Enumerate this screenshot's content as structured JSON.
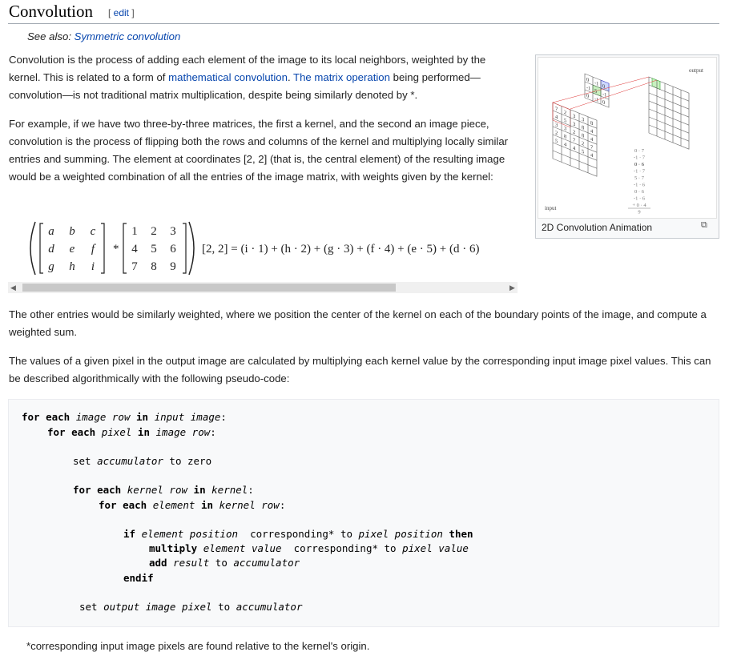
{
  "section": {
    "title": "Convolution",
    "edit_label": "edit",
    "edit_open": "[ ",
    "edit_close": " ]"
  },
  "see_also": {
    "prefix": "See also: ",
    "link": "Symmetric convolution"
  },
  "para1": {
    "text_a": "Convolution is the process of adding each element of the image to its local neighbors, weighted by the kernel. This is related to a form of ",
    "link1": "mathematical convolution",
    "text_b": ". ",
    "link2": "The matrix operation",
    "text_c": " being performed—convolution—is not traditional matrix multiplication, despite being similarly denoted by *."
  },
  "para2": "For example, if we have two three-by-three matrices, the first a kernel, and the second an image piece, convolution is the process of flipping both the rows and columns of the kernel and multiplying locally similar entries and summing. The element at coordinates [2, 2] (that is, the central element) of the resulting image would be a weighted combination of all the entries of the image matrix, with weights given by the kernel:",
  "figure": {
    "caption": "2D Convolution Animation",
    "label_output": "output",
    "label_input": "input",
    "kernel_grid": [
      [
        "0",
        "-1",
        "0"
      ],
      [
        "-1",
        "5",
        "-1"
      ],
      [
        "0",
        "-1",
        "0"
      ]
    ],
    "input_grid": [
      [
        "7",
        "2",
        "3",
        "3",
        "8"
      ],
      [
        "4",
        "5",
        "3",
        "8",
        "4"
      ],
      [
        "3",
        "3",
        "2",
        "8",
        "4"
      ],
      [
        "2",
        "8",
        "7",
        "2",
        "7"
      ],
      [
        "5",
        "4",
        "4",
        "5",
        "4"
      ]
    ],
    "calc_lines": [
      "0 · 7",
      "-1 · 7",
      "0 · 6",
      "-1 · 7",
      "5 · 7",
      "-1 · 6",
      "0 · 6",
      "-1 · 6",
      "+ 0 · 4",
      "9"
    ]
  },
  "equation": {
    "kernel": [
      [
        "a",
        "b",
        "c"
      ],
      [
        "d",
        "e",
        "f"
      ],
      [
        "g",
        "h",
        "i"
      ]
    ],
    "image": [
      [
        "1",
        "2",
        "3"
      ],
      [
        "4",
        "5",
        "6"
      ],
      [
        "7",
        "8",
        "9"
      ]
    ],
    "op": "*",
    "result": "[2, 2] = (i · 1) + (h · 2) + (g · 3) + (f · 4) + (e · 5) + (d · 6)"
  },
  "para3": "The other entries would be similarly weighted, where we position the center of the kernel on each of the boundary points of the image, and compute a weighted sum.",
  "para4": "The values of a given pixel in the output image are calculated by multiplying each kernel value by the corresponding input image pixel values. This can be described algorithmically with the following pseudo-code:",
  "pseudocode": {
    "l1": [
      "for each",
      " ",
      "image row",
      " ",
      "in",
      " ",
      "input image",
      ":"
    ],
    "l2": [
      "for each",
      " ",
      "pixel",
      " ",
      "in",
      " ",
      "image row",
      ":"
    ],
    "l3": [
      "set",
      " ",
      "accumulator",
      " to zero"
    ],
    "l4": [
      "for each",
      " ",
      "kernel row",
      " ",
      "in",
      " ",
      "kernel",
      ":"
    ],
    "l5": [
      "for each",
      " ",
      "element",
      " ",
      "in",
      " ",
      "kernel row",
      ":"
    ],
    "l6": [
      "if",
      " ",
      "element position",
      "  corresponding* to ",
      "pixel position",
      " ",
      "then"
    ],
    "l7": [
      "multiply",
      " ",
      "element value",
      "  corresponding* to ",
      "pixel value"
    ],
    "l8": [
      "add",
      " ",
      "result",
      " to ",
      "accumulator"
    ],
    "l9": [
      "endif"
    ],
    "l10": [
      "set",
      " ",
      "output image pixel",
      " to ",
      "accumulator"
    ]
  },
  "footnote": "*corresponding input image pixels are found relative to the kernel's origin."
}
